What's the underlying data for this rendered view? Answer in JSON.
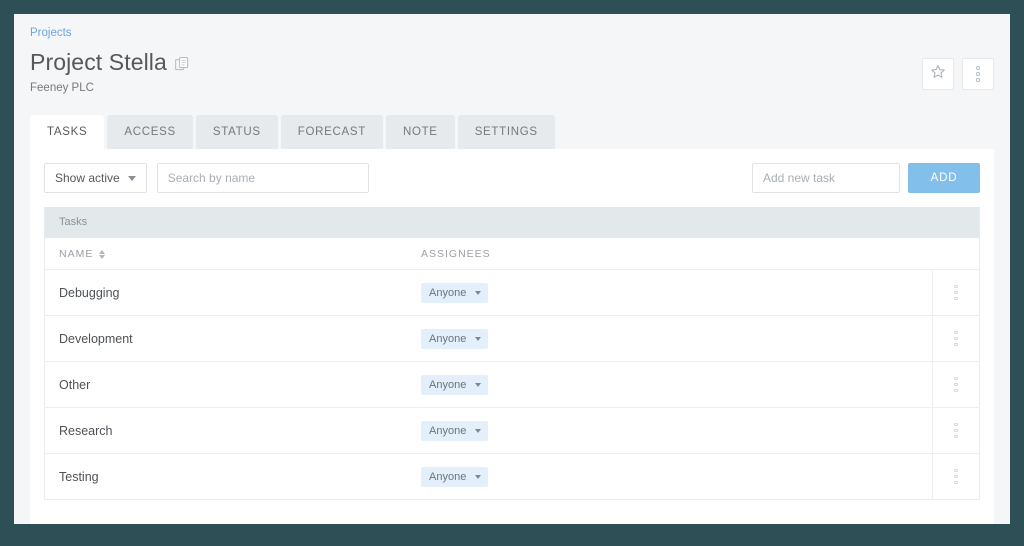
{
  "breadcrumb": {
    "label": "Projects"
  },
  "header": {
    "title": "Project Stella",
    "subtitle": "Feeney PLC",
    "copy_icon": "copy-pages-icon",
    "favorite_icon": "star-icon",
    "more_icon": "kebab-menu-icon"
  },
  "tabs": [
    {
      "label": "TASKS",
      "active": true
    },
    {
      "label": "ACCESS",
      "active": false
    },
    {
      "label": "STATUS",
      "active": false
    },
    {
      "label": "FORECAST",
      "active": false
    },
    {
      "label": "NOTE",
      "active": false
    },
    {
      "label": "SETTINGS",
      "active": false
    }
  ],
  "toolbar": {
    "filter_label": "Show active",
    "search_value": "",
    "search_placeholder": "Search by name",
    "new_task_value": "",
    "new_task_placeholder": "Add new task",
    "add_label": "ADD"
  },
  "table": {
    "band_label": "Tasks",
    "columns": {
      "name": "NAME",
      "assignees": "ASSIGNEES"
    },
    "sort_icon": "sort-updown-icon",
    "rows": [
      {
        "name": "Debugging",
        "assignee": "Anyone"
      },
      {
        "name": "Development",
        "assignee": "Anyone"
      },
      {
        "name": "Other",
        "assignee": "Anyone"
      },
      {
        "name": "Research",
        "assignee": "Anyone"
      },
      {
        "name": "Testing",
        "assignee": "Anyone"
      }
    ]
  },
  "colors": {
    "frame": "#2f4f57",
    "page_bg": "#f4f6f8",
    "accent": "#83bfeb",
    "link": "#6aa6e0",
    "chip_bg": "#e3f0fb",
    "band_bg": "#e3e8eb"
  }
}
